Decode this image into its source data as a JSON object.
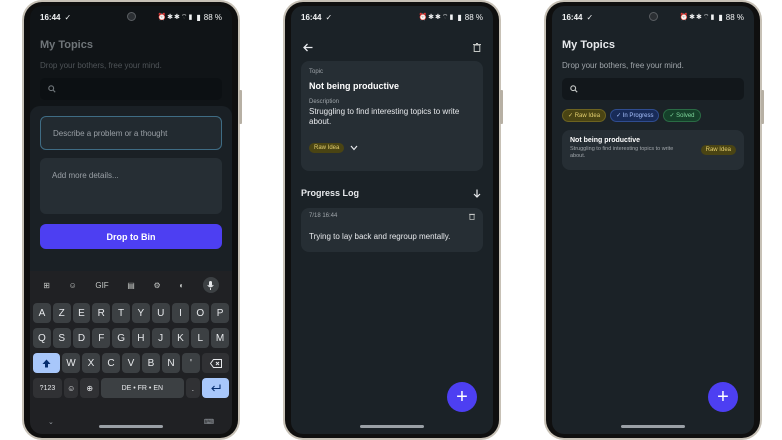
{
  "status": {
    "time": "16:44",
    "battery": "88 %"
  },
  "app": {
    "title": "My Topics",
    "subtitle": "Drop your bothers, free your mind."
  },
  "phone1": {
    "problem_placeholder": "Describe a problem or a thought",
    "details_placeholder": "Add more details...",
    "submit_label": "Drop to Bin",
    "keyboard": {
      "toolbar": [
        "⊞",
        "☺",
        "GIF",
        "▤",
        "⚙",
        "◐"
      ],
      "row1": [
        "A",
        "Z",
        "E",
        "R",
        "T",
        "Y",
        "U",
        "I",
        "O",
        "P"
      ],
      "row2": [
        "Q",
        "S",
        "D",
        "F",
        "G",
        "H",
        "J",
        "K",
        "L",
        "M"
      ],
      "row3": [
        "W",
        "X",
        "C",
        "V",
        "B",
        "N",
        "'"
      ],
      "symbols_key": "?123",
      "space_label": "DE • FR • EN",
      "period": "."
    }
  },
  "phone2": {
    "topic_label": "Topic",
    "topic_title": "Not being productive",
    "description_label": "Description",
    "description": "Struggling to find interesting topics to write about.",
    "status_tag": "Raw Idea",
    "progress_log_title": "Progress Log",
    "log_entry": {
      "date": "7/18 16:44",
      "text": "Trying to lay back and regroup mentally."
    },
    "fab_label": "+"
  },
  "phone3": {
    "filters": [
      "Raw Idea",
      "In Progress",
      "Solved"
    ],
    "item": {
      "title": "Not being productive",
      "description": "Struggling to find interesting topics to write about.",
      "tag": "Raw Idea"
    },
    "fab_label": "+"
  },
  "colors": {
    "accent": "#4d3ff2",
    "background": "#1b2227",
    "card": "#262e34",
    "raw_tag": "#e4cf6f"
  }
}
